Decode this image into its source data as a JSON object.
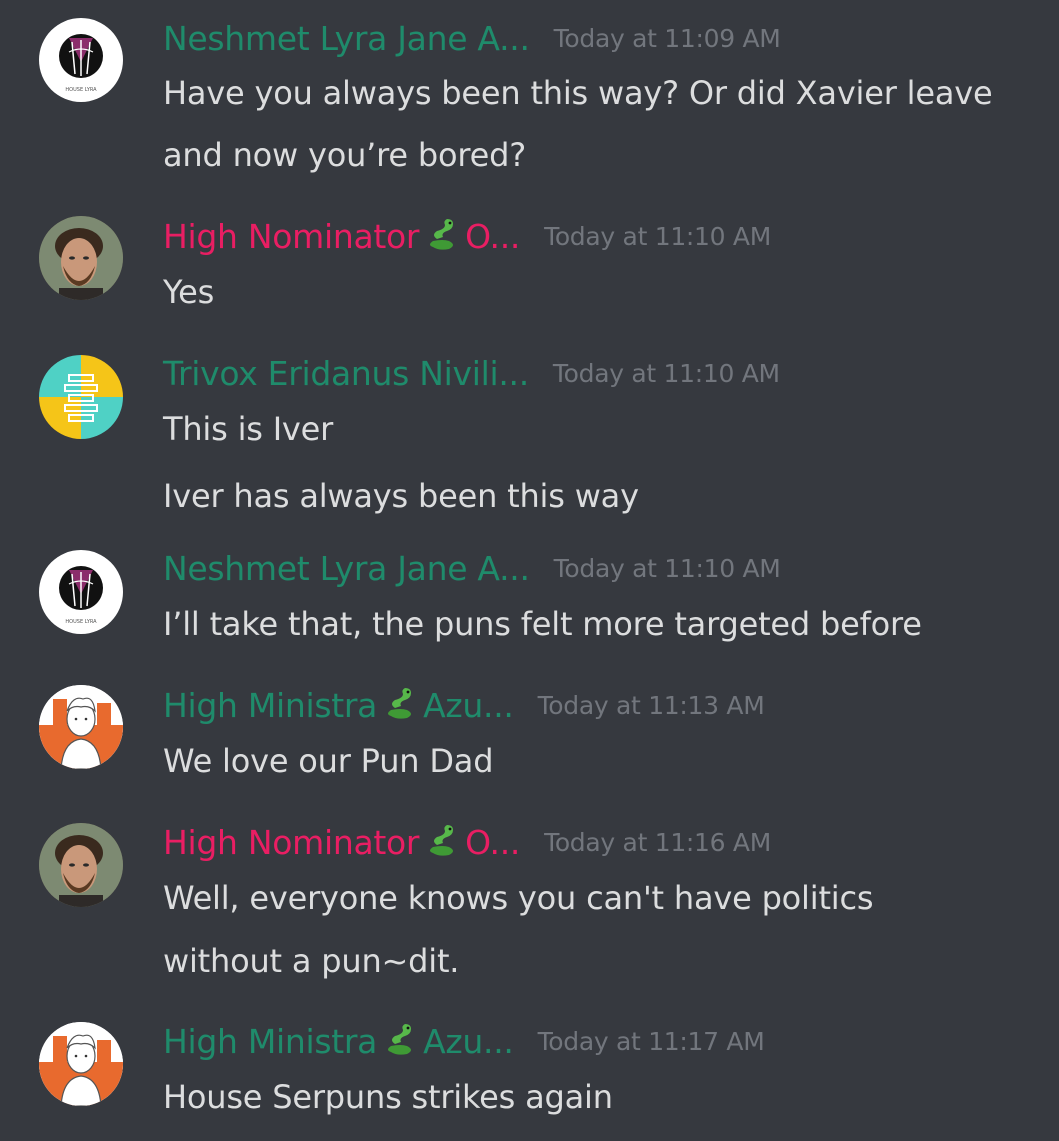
{
  "messages": [
    {
      "author": "Neshmet Lyra Jane A...",
      "author_color": "#1f8b6b",
      "avatar": "house-lyra-logo-icon",
      "avatar_caption": "HOUSE LYRA",
      "timestamp": "Today at 11:09 AM",
      "lines": [
        "Have you always been this way? Or did Xavier leave",
        "and now you’re bored?"
      ]
    },
    {
      "author_prefix": "High Nominator",
      "author_suffix": "O...",
      "author_color": "#e91e63",
      "avatar": "bearded-man-portrait-icon",
      "timestamp": "Today at 11:10 AM",
      "lines": [
        "Yes"
      ]
    },
    {
      "author": "Trivox Eridanus Nivili...",
      "author_color": "#1f8b6b",
      "avatar": "teal-yellow-emblem-icon",
      "timestamp": "Today at 11:10 AM",
      "lines": [
        "This is Iver",
        "Iver has always been this way"
      ]
    },
    {
      "author": "Neshmet Lyra Jane A...",
      "author_color": "#1f8b6b",
      "avatar": "house-lyra-logo-icon",
      "avatar_caption": "HOUSE LYRA",
      "timestamp": "Today at 11:10 AM",
      "lines": [
        "I’ll take that, the puns felt more targeted before"
      ]
    },
    {
      "author_prefix": "High Ministra",
      "author_suffix": "Azu...",
      "author_color": "#1f8b6b",
      "avatar": "cartoon-person-portrait-icon",
      "timestamp": "Today at 11:13 AM",
      "lines": [
        "We love our Pun Dad"
      ]
    },
    {
      "author_prefix": "High Nominator",
      "author_suffix": "O...",
      "author_color": "#e91e63",
      "avatar": "bearded-man-portrait-icon",
      "timestamp": "Today at 11:16 AM",
      "lines": [
        "Well, everyone knows you can't have politics",
        "without a pun~dit."
      ]
    },
    {
      "author_prefix": "High Ministra",
      "author_suffix": "Azu...",
      "author_color": "#1f8b6b",
      "avatar": "cartoon-person-portrait-icon",
      "timestamp": "Today at 11:17 AM",
      "lines": [
        "House Serpuns strikes again"
      ]
    }
  ],
  "colors": {
    "background": "#36393f",
    "message_text": "#dcddde",
    "timestamp": "#72767d",
    "role_green": "#1f8b6b",
    "role_pink": "#e91e63"
  },
  "icons": {
    "snake": "snake-emoji-icon"
  }
}
